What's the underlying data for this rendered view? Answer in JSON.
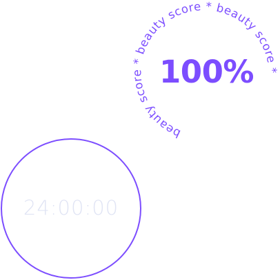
{
  "colors": {
    "accent": "#7c4dff",
    "timer_text": "#e0e4f4"
  },
  "beauty_badge": {
    "ring_text": "beauty score * beauty score * beauty score *",
    "score": "100%"
  },
  "timer": {
    "value": "24:00:00"
  }
}
